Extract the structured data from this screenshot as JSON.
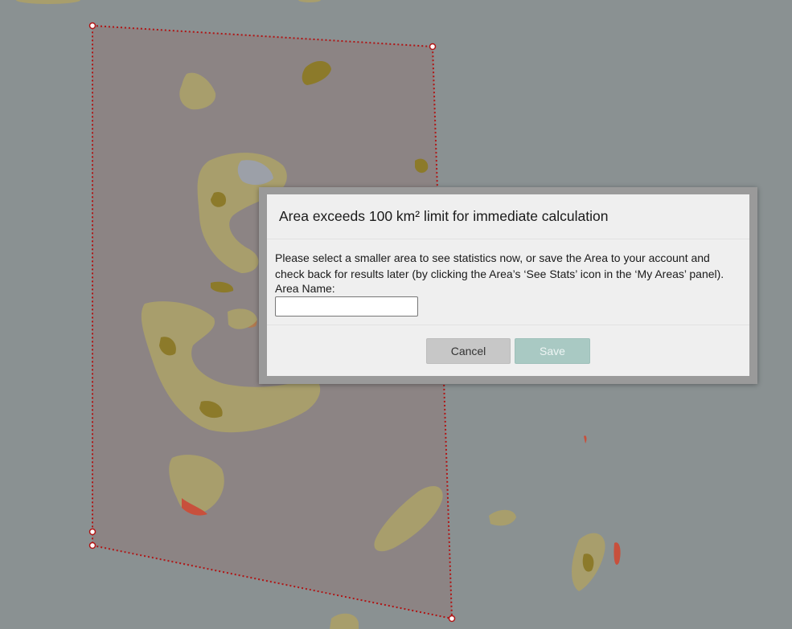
{
  "map": {
    "background_color": "#8a9192",
    "polygon_fill": "#8c8484",
    "polygon_stroke": "#b01515",
    "landform_colors": [
      "#a89e6c",
      "#8c7a2a",
      "#b07a50",
      "#9ca0a8",
      "#c8503c"
    ]
  },
  "dialog": {
    "title": "Area exceeds 100 km² limit for immediate calculation",
    "message": "Please select a smaller area to see statistics now, or save the Area to your account and check back for results later (by clicking the Area’s ‘See Stats’ icon in the ‘My Areas’ panel).",
    "area_name_label": "Area Name:",
    "area_name_value": "",
    "area_name_placeholder": "",
    "cancel_label": "Cancel",
    "save_label": "Save",
    "save_color": "#a9c9c3",
    "cancel_color": "#c7c7c7"
  }
}
